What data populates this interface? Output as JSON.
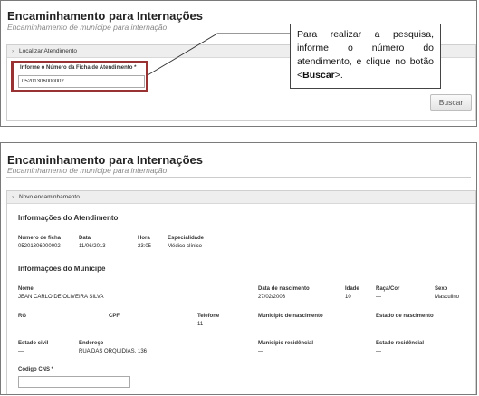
{
  "screen1": {
    "title": "Encaminhamento para Internações",
    "subtitle": "Encaminhamento de munícipe para internação",
    "panel_title": "Localizar Atendimento",
    "field_label": "Informe o Número da Ficha de Atendimento *",
    "field_value": "05201306000002",
    "search_button": "Buscar"
  },
  "callout": {
    "text_before": "Para realizar a pesquisa, informe o número do atendimento, e clique no botão <",
    "text_bold": "Buscar",
    "text_after": ">."
  },
  "screen2": {
    "title": "Encaminhamento para Internações",
    "subtitle": "Encaminhamento de munícipe para internação",
    "panel_title": "Novo encaminhamento",
    "atendimento": {
      "heading": "Informações do Atendimento",
      "labels": {
        "ficha": "Número de ficha",
        "data": "Data",
        "hora": "Hora",
        "especialidade": "Especialidade"
      },
      "values": {
        "ficha": "05201306000002",
        "data": "11/06/2013",
        "hora": "23:05",
        "especialidade": "Médico clínico"
      }
    },
    "municipe": {
      "heading": "Informações do Munícipe",
      "labels": {
        "nome": "Nome",
        "nascimento": "Data de nascimento",
        "idade": "Idade",
        "raca": "Raça/Cor",
        "sexo": "Sexo",
        "rg": "RG",
        "cpf": "CPF",
        "telefone": "Telefone",
        "municipio_nasc": "Município de nascimento",
        "estado_nasc": "Estado de nascimento",
        "estado_civil": "Estado civil",
        "endereco": "Endereço",
        "municipio_res": "Município residêncial",
        "estado_res": "Estado residêncial",
        "cns": "Código CNS *"
      },
      "values": {
        "nome": "JEAN CARLO DE OLIVEIRA SILVA",
        "nascimento": "27/02/2003",
        "idade": "10",
        "raca": "—",
        "sexo": "Masculino",
        "rg": "—",
        "cpf": "—",
        "telefone": "11",
        "municipio_nasc": "—",
        "estado_nasc": "—",
        "estado_civil": "—",
        "endereco": "RUA DAS ORQUIDIAS, 136",
        "municipio_res": "—",
        "estado_res": "—",
        "cns": ""
      }
    }
  }
}
